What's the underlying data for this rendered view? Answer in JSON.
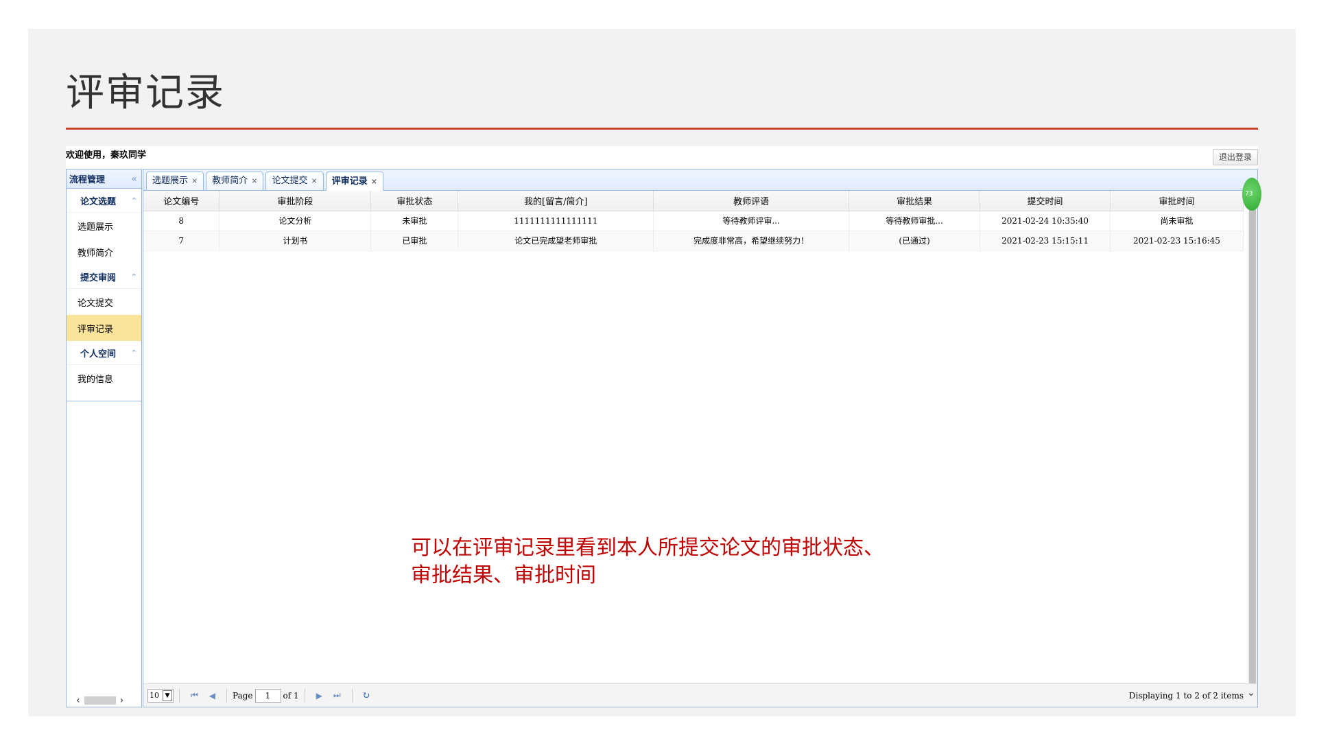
{
  "slide": {
    "title": "评审记录",
    "note_line1": "可以在评审记录里看到本人所提交论文的审批状态、",
    "note_line2": "审批结果、审批时间"
  },
  "header": {
    "welcome": "欢迎使用，秦玖同学",
    "logout_label": "退出登录"
  },
  "sidebar": {
    "title": "流程管理",
    "collapse_icon": "«",
    "groups": [
      {
        "label": "论文选题",
        "items": [
          "选题展示",
          "教师简介"
        ]
      },
      {
        "label": "提交审阅",
        "items": [
          "论文提交",
          "评审记录"
        ]
      },
      {
        "label": "个人空间",
        "items": [
          "我的信息"
        ]
      }
    ],
    "active_item": "评审记录"
  },
  "tabs": [
    {
      "label": "选题展示",
      "active": false
    },
    {
      "label": "教师简介",
      "active": false
    },
    {
      "label": "论文提交",
      "active": false
    },
    {
      "label": "评审记录",
      "active": true
    }
  ],
  "grid": {
    "columns": [
      "论文编号",
      "审批阶段",
      "审批状态",
      "我的[留言/简介]",
      "教师评语",
      "审批结果",
      "提交时间",
      "审批时间"
    ],
    "rows": [
      [
        "8",
        "论文分析",
        "未审批",
        "1111111111111111",
        "等待教师评审...",
        "等待教师审批...",
        "2021-02-24 10:35:40",
        "尚未审批"
      ],
      [
        "7",
        "计划书",
        "已审批",
        "论文已完成望老师审批",
        "完成度非常高，希望继续努力！",
        "(已通过)",
        "2021-02-23 15:15:11",
        "2021-02-23 15:16:45"
      ]
    ]
  },
  "pager": {
    "page_size": "10",
    "page_label": "Page",
    "page_value": "1",
    "of_label": "of 1",
    "display_info": "Displaying 1 to 2 of 2 items"
  },
  "badge": {
    "text": "73"
  },
  "colors": {
    "accent_rule": "#c8432a",
    "note": "#c00000",
    "panel_border": "#95b8e7",
    "active_item": "#fbe39a",
    "passed": "#e00000"
  }
}
